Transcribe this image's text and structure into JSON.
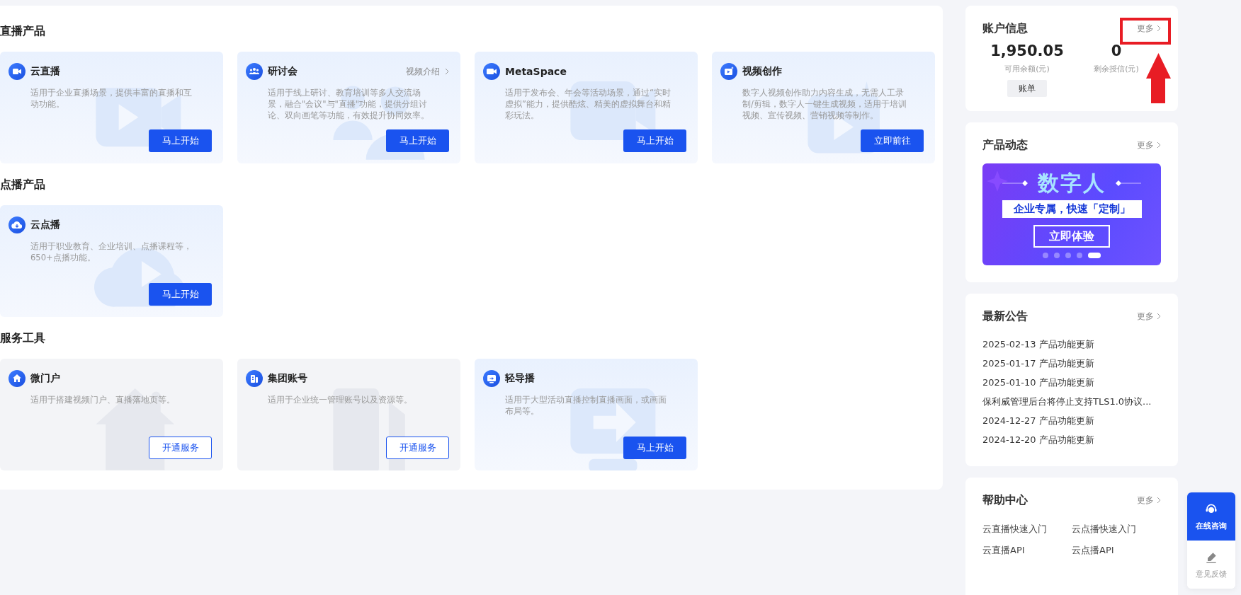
{
  "sections": [
    {
      "title": "直播产品",
      "cards": [
        {
          "title": "云直播",
          "description": "适用于企业直播场景，提供丰富的直播和互动功能。",
          "button": "马上开始"
        },
        {
          "title": "研讨会",
          "link": "视频介绍",
          "description": "适用于线上研讨、教育培训等多人交流场景，融合\"会议\"与\"直播\"功能，提供分组讨论、双向画笔等功能，有效提升协同效率。",
          "button": "马上开始"
        },
        {
          "title": "MetaSpace",
          "description": "适用于发布会、年会等活动场景，通过“实时虚拟”能力，提供酷炫、精美的虚拟舞台和精彩玩法。",
          "button": "马上开始"
        },
        {
          "title": "视频创作",
          "description": "数字人视频创作助力内容生成，无需人工录制/剪辑，数字人一键生成视频，适用于培训视频、宣传视频、营销视频等制作。",
          "button": "立即前往"
        }
      ]
    },
    {
      "title": "点播产品",
      "cards": [
        {
          "title": "云点播",
          "description": "适用于职业教育、企业培训、点播课程等，650+点播功能。",
          "button": "马上开始"
        }
      ]
    },
    {
      "title": "服务工具",
      "cards": [
        {
          "title": "微门户",
          "description": "适用于搭建视频门户、直播落地页等。",
          "button": "开通服务"
        },
        {
          "title": "集团账号",
          "description": "适用于企业统一管理账号以及资源等。",
          "button": "开通服务"
        },
        {
          "title": "轻导播",
          "description": "适用于大型活动直播控制直播画面，或画面布局等。",
          "button": "马上开始"
        }
      ]
    }
  ],
  "account": {
    "title": "账户信息",
    "more": "更多",
    "balance": {
      "value": "1,950.05",
      "label": "可用余额(元)",
      "button": "账单"
    },
    "credit": {
      "value": "0",
      "label": "剩余授信(元)"
    }
  },
  "annotations": {
    "highlight_box": true,
    "up_arrow": true
  },
  "news": {
    "title": "产品动态",
    "more": "更多",
    "banner": {
      "headline": "数字人",
      "ribbon": "企业专属，快速「定制」",
      "cta": "立即体验",
      "dots": [
        {
          "selected": false
        },
        {
          "selected": false
        },
        {
          "selected": false
        },
        {
          "selected": false
        },
        {
          "selected": true
        }
      ]
    }
  },
  "notices": {
    "title": "最新公告",
    "more": "更多",
    "items": [
      "2025-02-13 产品功能更新",
      "2025-01-17 产品功能更新",
      "2025-01-10 产品功能更新",
      "保利威管理后台将停止支持TLS1.0协议...",
      "2024-12-27 产品功能更新",
      "2024-12-20 产品功能更新"
    ]
  },
  "help": {
    "title": "帮助中心",
    "more": "更多",
    "links": [
      "云直播快速入门",
      "云点播快速入门",
      "云直播API",
      "云点播API"
    ]
  },
  "float_menu": [
    {
      "label": "在线咨询",
      "selected": true
    },
    {
      "label": "意见反馈",
      "selected": false
    }
  ]
}
